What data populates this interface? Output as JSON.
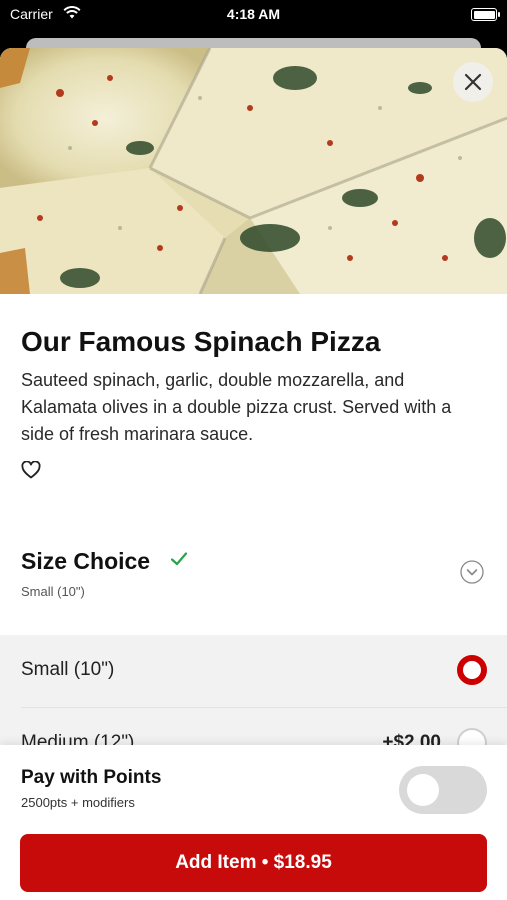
{
  "status_bar": {
    "carrier": "Carrier",
    "time": "4:18 AM"
  },
  "product": {
    "title": "Our Famous Spinach Pizza",
    "description": "Sauteed spinach, garlic, double mozzarella, and Kalamata olives in a double pizza crust. Served with a side of fresh marinara sauce."
  },
  "size_choice": {
    "heading": "Size Choice",
    "selected": "Small (10\")",
    "options": [
      {
        "label": "Small (10\")",
        "price": "",
        "selected": true
      },
      {
        "label": "Medium (12\")",
        "price": "+$2.00",
        "selected": false
      }
    ]
  },
  "pay_with_points": {
    "title": "Pay with Points",
    "subtitle": "2500pts + modifiers",
    "enabled": false
  },
  "add_button": {
    "label": "Add Item • $18.95"
  },
  "colors": {
    "accent": "#c70b0b",
    "check": "#2aa24a",
    "toggle_off": "#d9d9d9"
  }
}
